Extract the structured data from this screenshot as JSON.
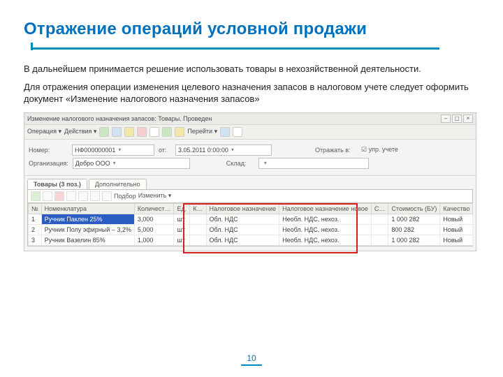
{
  "title": "Отражение операций условной продажи",
  "paragraph1": "В дальнейшем принимается решение использовать товары в нехозяйственной деятельности.",
  "paragraph2": "Для отражения операции изменения целевого назначения запасов в налоговом учете следует оформить документ «Изменение налогового назначения запасов»",
  "page_number": "10",
  "app": {
    "window_title": "Изменение налогового назначения запасов: Товары. Проведен",
    "toolbar": {
      "menu1": "Операция ▾",
      "menu2": "Действия ▾",
      "menu3": "Перейти ▾"
    },
    "form": {
      "label_number": "Номер:",
      "value_number": "НФ000000001",
      "label_date": "от:",
      "value_date": "3.05.2011   0:00:00",
      "label_otrazhat": "Отражать в:",
      "checkbox_upr": "упр. учете",
      "label_org": "Организация:",
      "value_org": "Добро ООО",
      "label_sklad": "Склад:",
      "value_sklad": ""
    },
    "tabs": {
      "tab1": "Товары (3 поз.)",
      "tab2": "Дополнительно"
    },
    "grid_toolbar": {
      "btn_more": "Подбор",
      "btn_change": "Изменить ▾"
    },
    "columns": {
      "num": "№",
      "nomen": "Номенклатура",
      "qty": "Количест…",
      "unit": "Ед.",
      "k": "К…",
      "purpose": "Налоговое назначение",
      "purpose_new": "Налоговое назначение новое",
      "schet": "С…",
      "cost": "Стоимость (БУ)",
      "quality": "Качество"
    },
    "rows": [
      {
        "num": "1",
        "nomen": "Ручник Паклен 25%",
        "qty": "3,000",
        "unit": "шт",
        "k": "",
        "purpose": "Обл. НДС",
        "purpose_new": "Необл. НДС, нехоз.",
        "schet": "",
        "cost": "1 000 282",
        "quality": "Новый"
      },
      {
        "num": "2",
        "nomen": "Ручник Полу эфирный – 3,2%",
        "qty": "5,000",
        "unit": "шт",
        "k": "",
        "purpose": "Обл. НДС",
        "purpose_new": "Необл. НДС, нехоз.",
        "schet": "",
        "cost": "800 282",
        "quality": "Новый"
      },
      {
        "num": "3",
        "nomen": "Ручник Вазелин 85%",
        "qty": "1,000",
        "unit": "шт",
        "k": "",
        "purpose": "Обл. НДС",
        "purpose_new": "Необл. НДС, нехоз.",
        "schet": "",
        "cost": "1 000 282",
        "quality": "Новый"
      }
    ]
  }
}
